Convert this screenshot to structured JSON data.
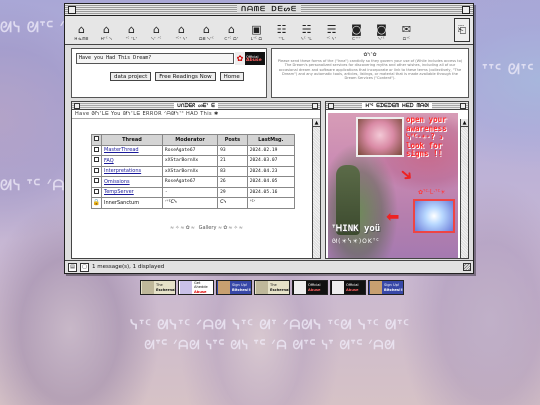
{
  "background": {
    "glyph_rows": [
      "ᘛᓭ ᘛᐪᑦ ᐟᗩᘛ",
      "ᐪᐪᑦ ᘛᐪᑦ",
      "ᘛᓭ ᐪᑦ ᐟᗩ",
      "ᓭᐪᑦ ᘛᓭᐪᑦ ᐟᗩᘛ ᓭᐪᑦ ᘛᐪ ᐟᗩᘛᓭ ᐪᑦᘛ ᓭᐪᑦ ᘛᐪᑦ",
      "ᘛᐪᑦ ᐟᗩᘛ ᓭᐪᑦ ᘛᓭ ᐪᑦ ᐟᗩ ᘛᐪᑦ ᓭᐪ ᘛᐪᑦ ᐟᗩᘛ"
    ]
  },
  "window": {
    "title": "ᑎᗩᗰᗴ ᗞᗴᔕᗴ",
    "toolbar": [
      {
        "icon": "home-icon",
        "glyph": "⌂",
        "label": "ᕼᓍᗰᗴ"
      },
      {
        "icon": "home-icon",
        "glyph": "⌂",
        "label": "ᕼᐪᑦ ᓭ"
      },
      {
        "icon": "house-icon",
        "glyph": "⌂",
        "label": "ᐪᑦ ᐪᒪᐪ"
      },
      {
        "icon": "house-icon",
        "glyph": "⌂",
        "label": "ᓭᐪ ᐟᑦ"
      },
      {
        "icon": "house-icon",
        "glyph": "⌂",
        "label": "ᐪᑦᐪ ᓭᐪ"
      },
      {
        "icon": "house-icon",
        "glyph": "⌂",
        "label": "ᗩᗴ ᓭᐪᑦ"
      },
      {
        "icon": "house-icon",
        "glyph": "⌂",
        "label": "ᑕᐪᑦ ᗩᐪ"
      },
      {
        "icon": "window-icon",
        "glyph": "▣",
        "label": "ᒪᐪᑦ ᗩ"
      },
      {
        "icon": "chat-icon",
        "glyph": "☷",
        "label": "ᐪᐪᒪ"
      },
      {
        "icon": "chat-icon",
        "glyph": "☵",
        "label": "ᓭᑦ ᐪᒪ"
      },
      {
        "icon": "chat-icon",
        "glyph": "☴",
        "label": "ᐪᑦ ᓭᐪ"
      },
      {
        "icon": "camera-icon",
        "glyph": "◙",
        "label": "ᑕᐪᐪᐪ"
      },
      {
        "icon": "camera-icon",
        "glyph": "◙",
        "label": "ᓭᐪᑦ"
      },
      {
        "icon": "mail-icon",
        "glyph": "✉",
        "label": "ᗩᐪᑦ"
      }
    ],
    "toolbar_end_icon": "back-icon",
    "search": {
      "value": "Have you Had This Dream?"
    },
    "buttons": [
      "data project",
      "Free Readings Now",
      "Home"
    ],
    "official_badge": {
      "line1": "Official",
      "line2": "Abuse"
    },
    "info": {
      "heading": "✿ᓭᐪ✿",
      "body": "Please send these forms of the (\"Inna\") candidly so they govern your use of (While includes access to) The Dream's personalized services for discovering myths and other wishes, including all of our occasional dream and software applications that incorporate or link to these terms (collectively, \"The Dream\") and any automatic tools, articles, listings, or material that is made available through the Dream Services (\"Content\")."
    },
    "forum": {
      "title": "ᑌᑎᗪᗴᖇ ᔕᗴᐪ ᗴ",
      "marquee": "Have ᘛᓭᐪᒪᗴ You  ᘛᓭᐪᒪᗴ ERROR ᐟᗩᘛᓭᐪᑦ HAD This ✱",
      "columns": [
        "Thread",
        "Moderator",
        "Posts",
        "LastMsg."
      ],
      "rows": [
        {
          "thread": "MasterThread",
          "moderator": "RoseAgate67",
          "posts": "93",
          "last": "2024.02.19",
          "link": true
        },
        {
          "thread": "FAQ",
          "moderator": "xXStarBornXx",
          "posts": "21",
          "last": "2024.03.07",
          "link": true
        },
        {
          "thread": "Interpretations",
          "moderator": "xXStarBornXx",
          "posts": "83",
          "last": "2024.04.23",
          "link": true
        },
        {
          "thread": "Omissions",
          "moderator": "RoseAgate67",
          "posts": "26",
          "last": "2024.04.05",
          "link": true
        },
        {
          "thread": "TempServer",
          "moderator": "-",
          "posts": "29",
          "last": "2024.05.16",
          "link": true
        },
        {
          "thread": "InnerSanctum",
          "moderator": "ᐟᐪᑦᑕᓭ",
          "posts": "ᑕᓭ",
          "last": "ᐪᑦᐟ",
          "link": false
        }
      ],
      "gallery_label": "Gallery"
    },
    "art": {
      "title": "ᕼᐪᑦ ᗴᗪᗴᗪᗴᗰ ᕼᗴᗪ ᗰᗩᘛ",
      "message": "open your awareness ᓭᐪᑦ·☀·? ↄ look for signs !!",
      "deco": "✿ᐪᑦ·ᒪ·ᐪᑦ☀",
      "think": "ᐪᕼINK yoü",
      "think_small": "ᘛ(☀ᓭ☀)OKᐪᑦ"
    },
    "status": "1 message(s), 1 displayed"
  },
  "badges": [
    {
      "kind": "eternal",
      "text1": "The",
      "text2": "Eschernal"
    },
    {
      "kind": "abuse",
      "text1": "Get Ahedde",
      "text2": "Abuse"
    },
    {
      "kind": "signup",
      "text1": "Sign Up!",
      "text2": "Bitches!!!"
    },
    {
      "kind": "eternal",
      "text1": "The",
      "text2": "Eschernal"
    },
    {
      "kind": "official",
      "text1": "Official",
      "text2": "Abuse"
    },
    {
      "kind": "official",
      "text1": "Official",
      "text2": "Abuse"
    },
    {
      "kind": "signup",
      "text1": "Sign Up!",
      "text2": "Bitches!!!"
    }
  ],
  "colors": {
    "accent_red": "#ff2a2a",
    "link_blue": "#1a1a9a",
    "signup_blue": "#3848a8"
  }
}
